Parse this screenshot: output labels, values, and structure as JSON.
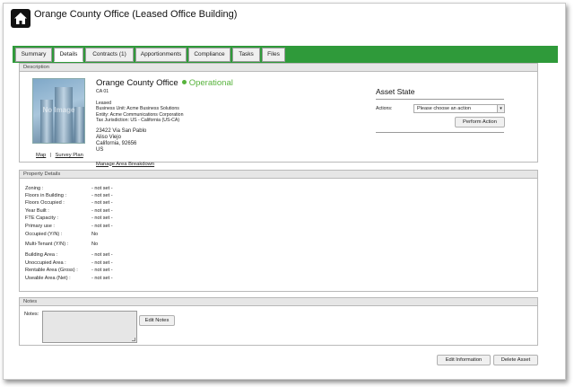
{
  "header": {
    "title": "Orange County Office (Leased Office Building)",
    "icon": "home-icon"
  },
  "tabs": [
    {
      "label": "Summary"
    },
    {
      "label": "Details",
      "active": true
    },
    {
      "label": "Contracts  (1)"
    },
    {
      "label": "Apportionments"
    },
    {
      "label": "Compliance"
    },
    {
      "label": "Tasks"
    },
    {
      "label": "Files"
    }
  ],
  "colors": {
    "tabbar": "#2f9a3a",
    "status": "#57b33c"
  },
  "description": {
    "header": "Description",
    "photo_text": "No Image",
    "map_link": "Map",
    "separator": "|",
    "survey_link": "Survey Plan",
    "office_name": "Orange County Office",
    "status": "Operational",
    "code": "CA 01",
    "lease_type": "Leased",
    "business_unit": "Business Unit: Acme Business Solutions",
    "entity": "Entity: Acme Communications Corporation",
    "tax_jurisdiction": "Tax Jurisdiction: US - California (US-CA)",
    "address": [
      "23422 Via San Pablo",
      "Aliso Viejo",
      "California, 92656",
      "US"
    ],
    "manage_link": "Manage Area Breakdown"
  },
  "asset_state": {
    "title": "Asset State",
    "actions_label": "Actions:",
    "select_value": "Please choose an action",
    "perform_button": "Perform Action"
  },
  "property_details": {
    "header": "Property Details",
    "rows": [
      {
        "label": "Zoning :",
        "value": "- not set -"
      },
      {
        "label": "Floors in Building :",
        "value": "- not set -"
      },
      {
        "label": "Floors Occupied :",
        "value": "- not set -"
      },
      {
        "label": "Year Built :",
        "value": "- not set -"
      },
      {
        "label": "FTE Capacity :",
        "value": "- not set -"
      },
      {
        "label": "Primary use :",
        "value": "- not set -"
      },
      {
        "label": "Occupied (Y/N) :",
        "value": "No"
      },
      {
        "label": "Multi-Tenant (Y/N) :",
        "value": "No"
      },
      {
        "label": "Building Area :",
        "value": "- not set -"
      },
      {
        "label": "Unoccupied Area :",
        "value": "- not set -"
      },
      {
        "label": "Rentable Area (Gross) :",
        "value": "- not set -"
      },
      {
        "label": "Useable Area (Net) :",
        "value": "- not set -"
      }
    ]
  },
  "notes": {
    "header": "Notes",
    "label": "Notes:",
    "edit_button": "Edit Notes"
  },
  "footer": {
    "edit_info_button": "Edit Information",
    "delete_button": "Delete Asset"
  }
}
